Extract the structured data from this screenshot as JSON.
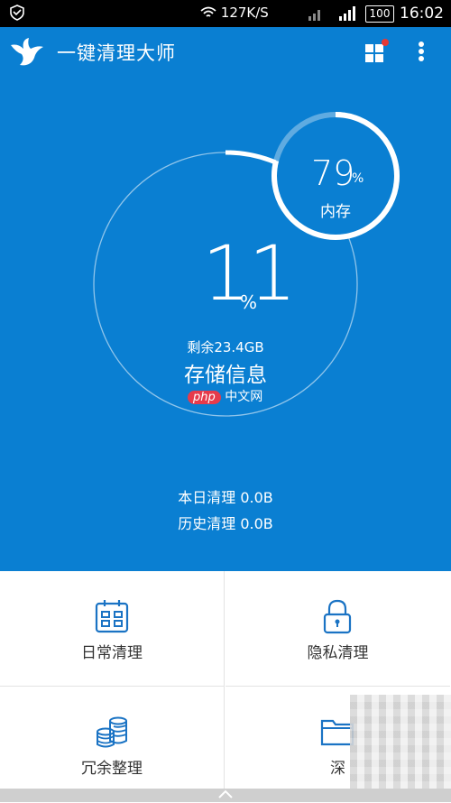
{
  "status_bar": {
    "network_speed": "127K/S",
    "battery": "100",
    "time": "16:02"
  },
  "app_bar": {
    "title": "一键清理大师",
    "icons": [
      "shield-icon",
      "bird-logo-icon",
      "grid-icon",
      "more-vert-icon"
    ]
  },
  "storage": {
    "percent": "11",
    "percent_sign": "%",
    "remaining": "剩余23.4GB",
    "label": "存储信息",
    "usage_fraction": 0.11
  },
  "memory": {
    "percent": "79",
    "percent_sign": "%",
    "label": "内存",
    "usage_fraction": 0.79
  },
  "watermark": {
    "php": "php",
    "site": "中文网"
  },
  "stats": {
    "today": "本日清理 0.0B",
    "history": "历史清理 0.0B"
  },
  "tiles": [
    {
      "label": "日常清理",
      "icon": "calendar-icon"
    },
    {
      "label": "隐私清理",
      "icon": "lock-icon"
    },
    {
      "label": "冗余整理",
      "icon": "coins-icon"
    },
    {
      "label": "深",
      "icon": "folder-icon"
    }
  ],
  "colors": {
    "primary": "#0a7fd2",
    "tile_icon": "#1a73c4",
    "badge": "#e53935"
  }
}
